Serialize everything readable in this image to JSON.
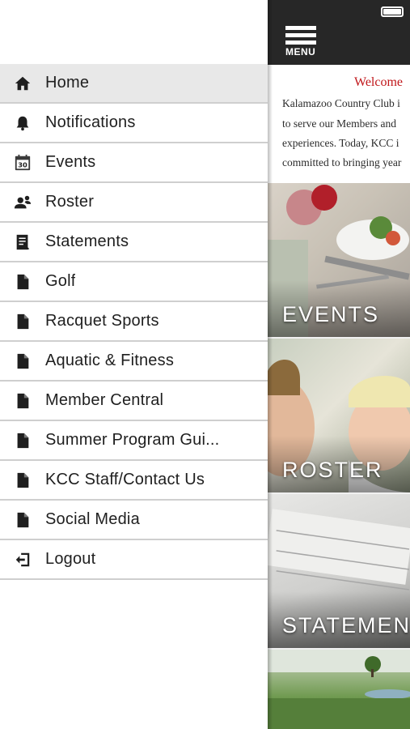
{
  "drawer": {
    "items": [
      {
        "label": "Home",
        "icon": "home-icon",
        "active": true
      },
      {
        "label": "Notifications",
        "icon": "bell-icon"
      },
      {
        "label": "Events",
        "icon": "calendar-icon"
      },
      {
        "label": "Roster",
        "icon": "people-icon"
      },
      {
        "label": "Statements",
        "icon": "statement-icon"
      },
      {
        "label": "Golf",
        "icon": "document-icon"
      },
      {
        "label": "Racquet Sports",
        "icon": "document-icon"
      },
      {
        "label": "Aquatic & Fitness",
        "icon": "document-icon"
      },
      {
        "label": "Member Central",
        "icon": "document-icon"
      },
      {
        "label": "Summer Program Gui...",
        "icon": "document-icon"
      },
      {
        "label": "KCC Staff/Contact Us",
        "icon": "document-icon"
      },
      {
        "label": "Social Media",
        "icon": "document-icon"
      },
      {
        "label": "Logout",
        "icon": "logout-icon"
      }
    ],
    "calendar_day": "30"
  },
  "main": {
    "menu_label": "MENU",
    "welcome": {
      "title": "Welcome",
      "lines": [
        "Kalamazoo Country Club i",
        "to serve our Members and",
        "experiences. Today, KCC i",
        "committed to bringing year"
      ]
    },
    "tiles": [
      {
        "label": "EVENTS"
      },
      {
        "label": "ROSTER"
      },
      {
        "label": "STATEMEN"
      },
      {
        "label": ""
      }
    ]
  },
  "colors": {
    "topbar": "#272727",
    "welcome_title": "#c0161a",
    "active_item_bg": "#e8e8e8",
    "divider": "#cfcfcf"
  }
}
